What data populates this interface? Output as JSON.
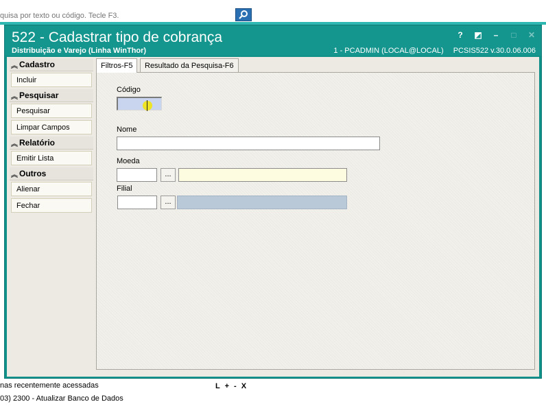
{
  "topbar": {
    "search_placeholder": "quisa por texto ou código. Tecle F3.",
    "search_icon": "magnifier-icon"
  },
  "window": {
    "title": "522 - Cadastrar tipo de cobrança",
    "subtitle": "Distribuição e Varejo (Linha WinThor)",
    "user": "1 - PCADMIN (LOCAL@LOCAL)",
    "version": "PCSIS522  v.30.0.06.006",
    "controls": {
      "help": "?",
      "toggle": "◩",
      "minimize": "–",
      "maximize": "□",
      "close": "✕"
    }
  },
  "sidebar": {
    "groups": [
      {
        "title": "Cadastro",
        "items": [
          "Incluir"
        ]
      },
      {
        "title": "Pesquisar",
        "items": [
          "Pesquisar",
          "Limpar Campos"
        ]
      },
      {
        "title": "Relatório",
        "items": [
          "Emitir Lista"
        ]
      },
      {
        "title": "Outros",
        "items": [
          "Alienar",
          "Fechar"
        ]
      }
    ]
  },
  "tabs": [
    "Filtros-F5",
    "Resultado da Pesquisa-F6"
  ],
  "form": {
    "codigo_label": "Código",
    "codigo_value": "",
    "nome_label": "Nome",
    "nome_value": "",
    "moeda_label": "Moeda",
    "moeda_value": "",
    "moeda_desc": "",
    "filial_label": "Filial",
    "filial_value": "",
    "filial_desc": "",
    "lookup_label": "..."
  },
  "footer": {
    "recent_label": "nas recentemente acessadas",
    "lpx": "L + - X",
    "recent_item": "03)  2300 - Atualizar Banco de Dados"
  },
  "colors": {
    "titlebar": "#14958e",
    "accent_strip": "#2fb7b1",
    "field_highlight": "#c9d4ef",
    "moeda_desc_bg": "#fdfbe0",
    "filial_desc_bg": "#b9c9d8"
  }
}
